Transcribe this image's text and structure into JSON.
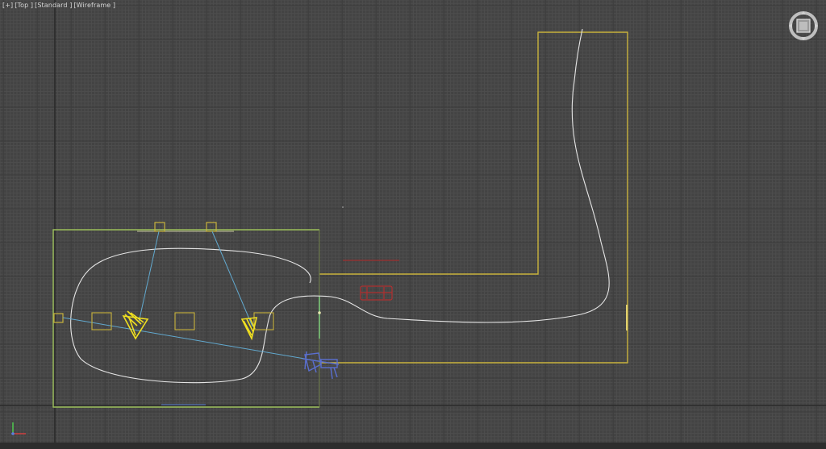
{
  "viewport": {
    "label_plus": "[+]",
    "label_view": "[Top ]",
    "label_shading": "[Standard ]",
    "label_display": "[Wireframe ]"
  },
  "icons": {
    "viewcube": "viewcube-icon",
    "axis_tripod": "axis-tripod-icon"
  },
  "colors": {
    "background": "#434343",
    "grid_minor": "#4d4d4d",
    "grid_major": "#2a2a2a",
    "yellow_wire": "#c8b23c",
    "green_wire": "#9bbf5a",
    "spline_white": "#e6e6e6",
    "light_target": "#62a9cf",
    "camera_blue": "#5a6fd0",
    "red_object": "#b03030"
  }
}
